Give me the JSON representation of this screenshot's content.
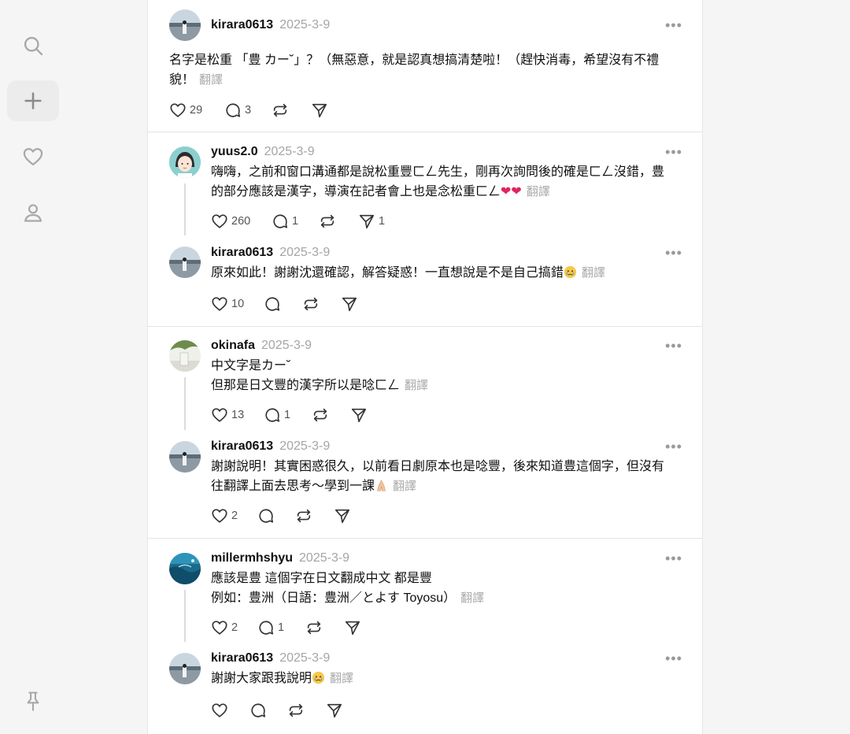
{
  "posts": [
    {
      "user": "kirara0613",
      "date": "2025-3-9",
      "lines": [
        "名字是松重 「豊 カー˘」？（無惡意，就是認真想搞清楚啦！（趕快消毒，希望沒有不禮",
        "貌！"
      ],
      "translate": "翻譯",
      "likes": "29",
      "replies": "3",
      "reposts": "",
      "shares": ""
    },
    {
      "user": "yuus2.0",
      "date": "2025-3-9",
      "lines": [
        "嗨嗨，之前和窗口溝通都是說松重豐ㄈㄥ先生，剛再次詢問後的確是ㄈㄥ沒錯，豊",
        "的部分應該是漢字，導演在記者會上也是念松重ㄈㄥ"
      ],
      "translate": "翻譯",
      "likes": "260",
      "replies": "1",
      "reposts": "",
      "shares": "1"
    },
    {
      "user": "kirara0613",
      "date": "2025-3-9",
      "lines": [
        "原來如此！謝謝沈還確認，解答疑惑！一直想說是不是自己搞錯"
      ],
      "translate": "翻譯",
      "likes": "10",
      "replies": "",
      "reposts": "",
      "shares": ""
    },
    {
      "user": "okinafa",
      "date": "2025-3-9",
      "lines": [
        "中文字是カー˘",
        "但那是日文豐的漢字所以是唸ㄈㄥ"
      ],
      "translate": "翻譯",
      "likes": "13",
      "replies": "1",
      "reposts": "",
      "shares": ""
    },
    {
      "user": "kirara0613",
      "date": "2025-3-9",
      "lines": [
        "謝謝說明！其實困惑很久，以前看日劇原本也是唸豐，後來知道豊這個字，但沒有",
        "往翻譯上面去思考～學到一課"
      ],
      "translate": "翻譯",
      "likes": "2",
      "replies": "",
      "reposts": "",
      "shares": ""
    },
    {
      "user": "millermhshyu",
      "date": "2025-3-9",
      "lines": [
        "應該是豊 這個字在日文翻成中文 都是豐",
        "例如：豊洲（日語：豊洲／とよす Toyosu）"
      ],
      "translate": "翻譯",
      "likes": "2",
      "replies": "1",
      "reposts": "",
      "shares": ""
    },
    {
      "user": "kirara0613",
      "date": "2025-3-9",
      "lines": [
        "謝謝大家跟我說明"
      ],
      "translate": "翻譯",
      "likes": "",
      "replies": "",
      "reposts": "",
      "shares": ""
    }
  ],
  "nav": [
    "search-icon",
    "plus-icon",
    "heart-icon",
    "profile-icon",
    "pin-icon"
  ],
  "colors": {
    "heart": "#e0245e",
    "muted": "#a5a5a5",
    "rail_active_bg": "#ececec"
  }
}
